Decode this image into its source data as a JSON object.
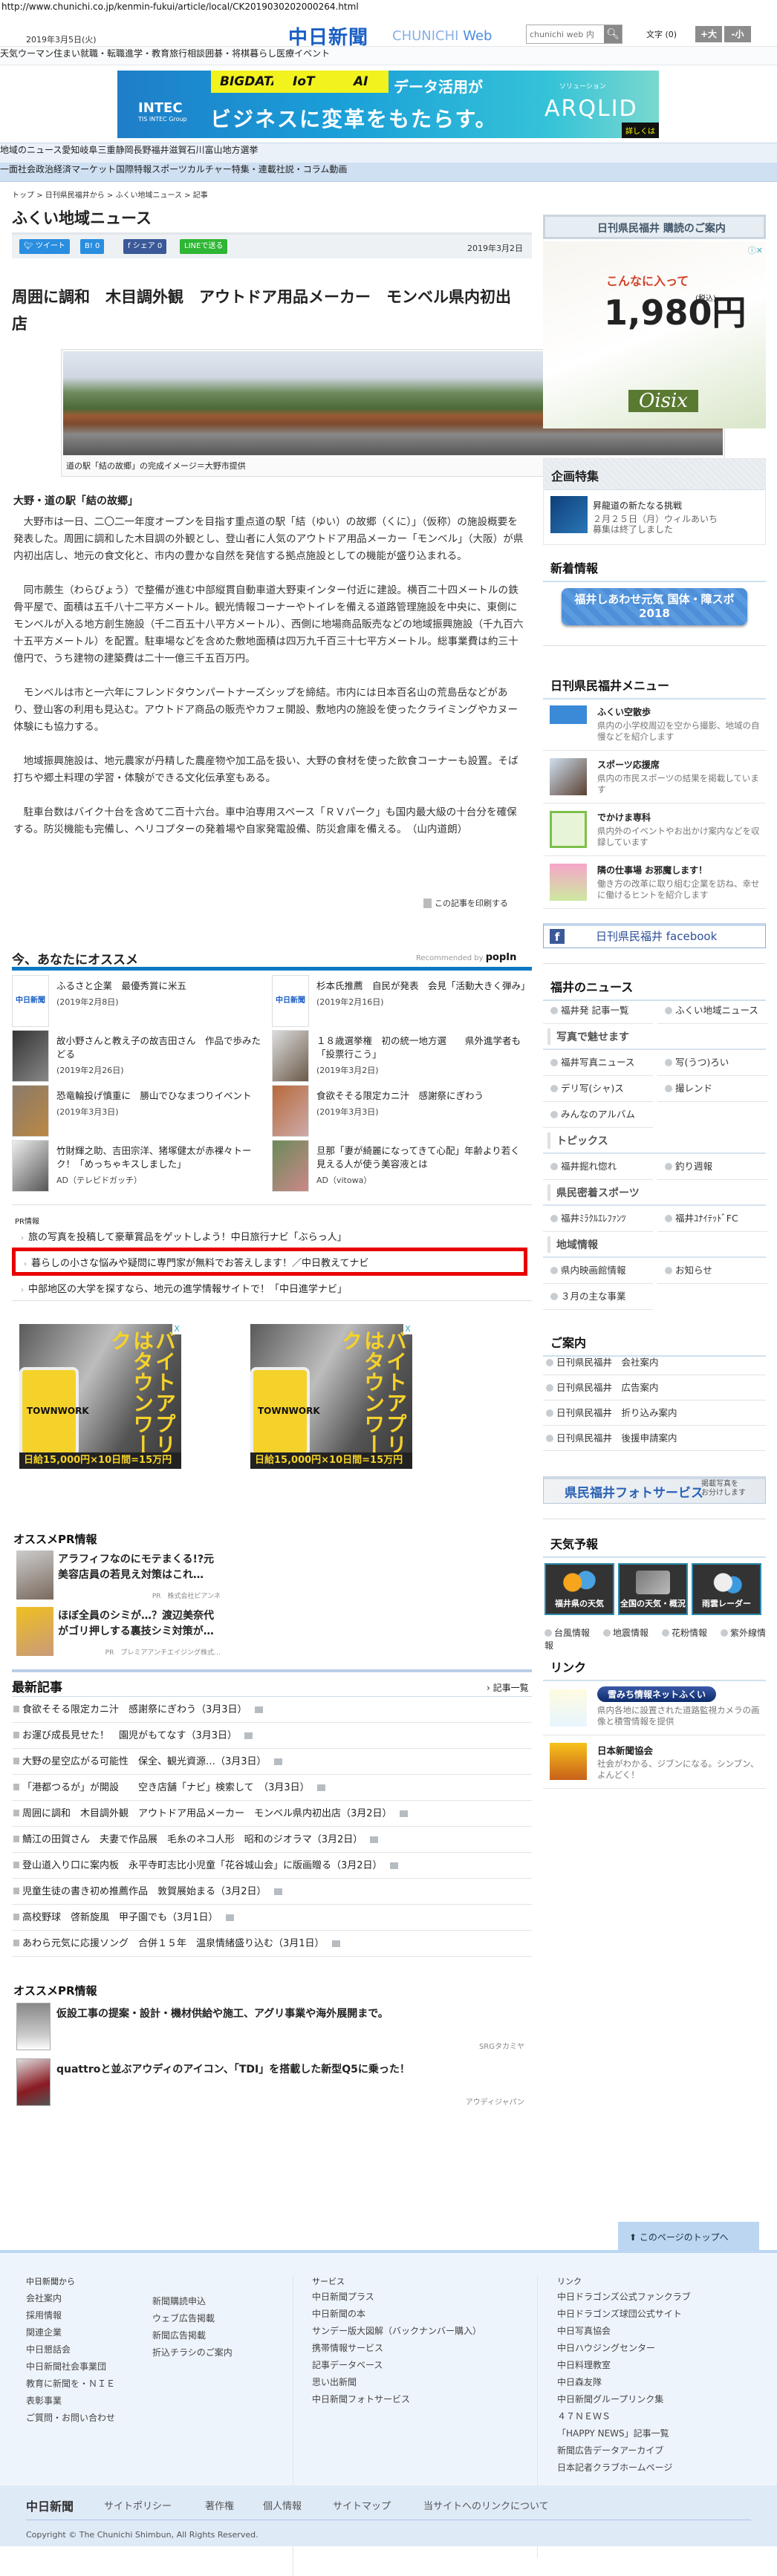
{
  "url": "http://www.chunichi.co.jp/kenmin-fukui/article/local/CK2019030202000264.html",
  "header": {
    "date": "2019年3月5日(火)",
    "logo_jp": "中日新聞",
    "logo_en_a": "CHUNICHI",
    "logo_en_b": "Web",
    "search_placeholder": "chunichi web 内",
    "font_size_label": "文字 (0)",
    "font_larger": "+大",
    "font_smaller": "-小"
  },
  "nav_top": [
    "天気",
    "ウーマン",
    "住まい",
    "就職・転職",
    "進学・教育",
    "旅行",
    "相談",
    "囲碁・将棋",
    "暮らし",
    "医療",
    "イベント"
  ],
  "banner_ad": {
    "company": "INTEC",
    "group": "TIS INTEC Group",
    "keywords": [
      "BIGDATA",
      "IoT",
      "AI"
    ],
    "line1": "データ活用が",
    "line2": "ビジネスに変革をもたらす。",
    "solution": "ソリューション",
    "product": "ARQLID",
    "more": "詳しくは"
  },
  "nav_region": [
    "地域のニュース",
    "愛知",
    "岐阜",
    "三重",
    "静岡",
    "長野",
    "福井",
    "滋賀",
    "石川",
    "富山",
    "地方選挙"
  ],
  "nav_category": [
    "一面",
    "社会",
    "政治",
    "経済",
    "マーケット",
    "国際",
    "特報",
    "スポーツ",
    "カルチャー",
    "特集・連載",
    "社説・コラム",
    "動画"
  ],
  "breadcrumb": "トップ > 日刊県民福井から > ふくい地域ニュース > 記事",
  "section_title": "ふくい地域ニュース",
  "share": {
    "tweet": "ツイート",
    "hatena": "B! 0",
    "facebook": "シェア 0",
    "line": "LINEで送る",
    "date": "2019年3月2日"
  },
  "article": {
    "headline": "周囲に調和　木目調外観　アウトドア用品メーカー　モンベル県内初出店",
    "caption": "道の駅「結の故郷」の完成イメージ＝大野市提供",
    "subhead": "大野・道の駅「結の故郷」",
    "paragraphs": [
      "大野市は一日、二〇二一年度オープンを目指す重点道の駅「結（ゆい）の故郷（くに）」（仮称）の施設概要を発表した。周囲に調和した木目調の外観とし、登山者に人気のアウトドア用品メーカー「モンベル」（大阪）が県内初出店し、地元の食文化と、市内の豊かな自然を発信する拠点施設としての機能が盛り込まれる。",
      "同市蕨生（わらびょう）で整備が進む中部縦貫自動車道大野東インター付近に建設。横百二十四メートルの鉄骨平屋で、面積は五千八十二平方メートル。観光情報コーナーやトイレを備える道路管理施設を中央に、東側にモンベルが入る地方創生施設（千二百五十八平方メートル）、西側に地場商品販売などの地域振興施設（千九百六十五平方メートル）を配置。駐車場などを含めた敷地面積は四万九千百三十七平方メートル。総事業費は約三十億円で、うち建物の建築費は二十一億三千五百万円。",
      "モンベルは市と一六年にフレンドタウンパートナーズシップを締結。市内には日本百名山の荒島岳などがあり、登山客の利用も見込む。アウトドア商品の販売やカフェ開設、敷地内の施設を使ったクライミングやカヌー体験にも協力する。",
      "地域振興施設は、地元農家が丹精した農産物や加工品を扱い、大野の食材を使った飲食コーナーも設置。そば打ちや郷土料理の学習・体験ができる文化伝承室もある。",
      "駐車台数はバイク十台を含めて二百十六台。車中泊専用スペース「ＲＶパーク」も国内最大級の十台分を確保する。防災機能も完備し、ヘリコプターの発着場や自家発電設備、防災倉庫を備える。　（山内道朗）"
    ],
    "print": "この記事を印刷する"
  },
  "recommend": {
    "title": "今、あなたにオススメ",
    "by": "Recommended by",
    "brand": "popIn",
    "items": [
      {
        "title": "ふるさと企業　最優秀賞に米五",
        "date": "(2019年2月8日)"
      },
      {
        "title": "杉本氏推薦　自民が発表　会見「活動大きく弾み」",
        "date": "(2019年2月16日)"
      },
      {
        "title": "故小野さんと教え子の故吉田さん　作品で歩みたどる",
        "date": "(2019年2月26日)"
      },
      {
        "title": "１８歳選挙権　初の統一地方選　　県外進学者も「投票行こう」",
        "date": "(2019年3月2日)"
      },
      {
        "title": "恐竜輪投げ慎重に　勝山でひなまつりイベント",
        "date": "(2019年3月3日)"
      },
      {
        "title": "食欲そそる限定カニ汁　感謝祭にぎわう",
        "date": "(2019年3月3日)"
      },
      {
        "title": "竹財輝之助、吉田宗洋、猪塚健太が赤裸々トーク！「めっちゃキスしました」",
        "date": "AD（テレビドガッチ）"
      },
      {
        "title": "旦那「妻が綺麗になってきて心配」年齢より若く見える人が使う美容液とは",
        "date": "AD（vitowa）"
      }
    ]
  },
  "pr_info": {
    "label": "PR情報",
    "items": [
      "旅の写真を投稿して豪華賞品をゲットしよう！中日旅行ナビ「ぶらっ人」",
      "暮らしの小さな悩みや疑問に専門家が無料でお答えします！／中日教えてナビ",
      "中部地区の大学を探すなら、地元の進学情報サイトで！「中日進学ナビ」"
    ]
  },
  "ads": {
    "headline": "バイトアプリはタウンワーク",
    "brand": "TOWNWORK",
    "bottom": "日給15,000円×10日間=15万円",
    "close": "X"
  },
  "pr_recommend_1": {
    "title": "オススメPR情報",
    "items": [
      {
        "title": "アラフィフなのにモテまくる!?元美容店員の若見え対策はこれ…",
        "sponsor": "PR　株式会社ビアンネ"
      },
      {
        "title": "ほぼ全員のシミが…？渡辺美奈代がゴリ押しする裏技シミ対策が…",
        "sponsor": "PR　プレミアアンチエイジング株式…"
      }
    ]
  },
  "latest": {
    "title": "最新記事",
    "more": "記事一覧",
    "items": [
      "食欲そそる限定カニ汁　感謝祭にぎわう（3月3日）",
      "お運び成長見せた！　園児がもてなす（3月3日）",
      "大野の星空広がる可能性　保全、観光資源…（3月3日）",
      "「港都つるが」が開設　　空き店舗「ナビ」検索して　（3月3日）",
      "周囲に調和　木目調外観　アウトドア用品メーカー　モンベル県内初出店（3月2日）",
      "鯖江の田賀さん　夫妻で作品展　毛糸のネコ人形　昭和のジオラマ（3月2日）",
      "登山道入り口に案内板　永平寺町志比小児童「花谷城山会」に版画贈る（3月2日）",
      "児童生徒の書き初め推薦作品　敦賀展始まる（3月2日）",
      "高校野球　啓新旋風　甲子園でも（3月1日）",
      "あわら元気に応援ソング　合併１５年　温泉情緒盛り込む（3月1日）"
    ]
  },
  "pr_recommend_2": {
    "title": "オススメPR情報",
    "items": [
      {
        "title": "仮設工事の提案・設計・機材供給や施工、アグリ事業や海外展開まで。",
        "sponsor": "SRGタカミヤ"
      },
      {
        "title": "quattroと並ぶアウディのアイコン、「TDI」を搭載した新型Q5に乗った！",
        "sponsor": "アウディジャパン"
      }
    ]
  },
  "sidebar": {
    "subscribe": "日刊県民福井 購読のご案内",
    "side_ad": {
      "line1": "こんなに入って",
      "price": "1,980円",
      "tax": "(税込)",
      "brand": "Oisix"
    },
    "kikaku": {
      "title": "企画特集",
      "item_title": "昇龍道の新たなる挑戦",
      "item_desc1": "２月２５日（月）ウィルあいち",
      "item_desc2": "募集は終了しました"
    },
    "shinchaku": {
      "title": "新着情報",
      "banner": "福井しあわせ元気 国体・障スポ2018"
    },
    "menu": {
      "title": "日刊県民福井メニュー",
      "items": [
        {
          "title": "ふくい空散歩",
          "desc": "県内の小学校周辺を空から撮影、地域の自慢などを紹介します"
        },
        {
          "title": "スポーツ応援席",
          "desc": "県内の市民スポーツの結果を掲載しています"
        },
        {
          "title": "でかけま専科",
          "desc": "県内外のイベントやお出かけ案内などを収録しています"
        },
        {
          "title": "隣の仕事場 お邪魔します！",
          "desc": "働き方の改革に取り組む企業を訪ね、幸せに働けるヒントを紹介します"
        }
      ]
    },
    "facebook": "日刊県民福井 facebook",
    "fukui_news": {
      "title": "福井のニュース",
      "rows": [
        {
          "type": "row",
          "items": [
            "福井発 記事一覧",
            "ふくい地域ニュース"
          ]
        },
        {
          "type": "sub",
          "label": "写真で魅せます"
        },
        {
          "type": "row",
          "items": [
            "福井写真ニュース",
            "写(うつ)ろい"
          ]
        },
        {
          "type": "row",
          "items": [
            "デリ写(シャ)ス",
            "撮レンド"
          ]
        },
        {
          "type": "row",
          "items": [
            "みんなのアルバム"
          ]
        },
        {
          "type": "sub",
          "label": "トピックス"
        },
        {
          "type": "row",
          "items": [
            "福井掘れ惚れ",
            "釣り週報"
          ]
        },
        {
          "type": "sub",
          "label": "県民密着スポーツ"
        },
        {
          "type": "row",
          "items": [
            "福井ﾐﾗｸﾙｴﾚﾌｧﾝﾂ",
            "福井ﾕﾅｲﾃｯﾄﾞFC"
          ]
        },
        {
          "type": "sub",
          "label": "地域情報"
        },
        {
          "type": "row",
          "items": [
            "県内映画館情報",
            "お知らせ"
          ]
        },
        {
          "type": "row",
          "items": [
            "３月の主な事業"
          ]
        }
      ]
    },
    "annai": {
      "title": "ご案内",
      "items": [
        "日刊県民福井　会社案内",
        "日刊県民福井　広告案内",
        "日刊県民福井　折り込み案内",
        "日刊県民福井　後援申請案内"
      ]
    },
    "photo_service": {
      "title": "県民福井フォトサービス",
      "sub1": "掲載写真を",
      "sub2": "お分けします"
    },
    "weather": {
      "title": "天気予報",
      "tiles": [
        "福井県の天気",
        "全国の天気・概況",
        "雨雲レーダー"
      ],
      "links": [
        "台風情報",
        "地震情報",
        "花粉情報",
        "紫外線情報"
      ]
    },
    "links": {
      "title": "リンク",
      "items": [
        {
          "title": "雪みち情報ネットふくい",
          "desc": "県内各地に設置された道路監視カメラの画像と積雪情報を提供"
        },
        {
          "title": "日本新聞協会",
          "desc": "社会がわかる、ジブンになる。シンブン、よんどく！"
        }
      ]
    }
  },
  "footer": {
    "to_top": "このページのトップへ",
    "col1_title": "中日新聞から",
    "col1a": [
      "会社案内",
      "採用情報",
      "関連企業",
      "中日懇話会",
      "中日新聞社会事業団",
      "教育に新聞を・ＮＩＥ",
      "表彰事業",
      "ご質問・お問い合わせ"
    ],
    "col1b": [
      "新聞購読申込",
      "ウェブ広告掲載",
      "新聞広告掲載",
      "折込チラシのご案内"
    ],
    "col2_title": "サービス",
    "col2": [
      "中日新聞プラス",
      "中日新聞の本",
      "サンデー版大図解（バックナンバー購入）",
      "携帯情報サービス",
      "記事データベース",
      "思い出新聞",
      "中日新聞フォトサービス"
    ],
    "col3_title": "リンク",
    "col3": [
      "中日ドラゴンズ公式ファンクラブ",
      "中日ドラゴンズ球団公式サイト",
      "中日写真協会",
      "中日ハウジングセンター",
      "中日料理教室",
      "中日森友隊",
      "中日新聞グループリンク集",
      "４７ＮＥＷＳ",
      "「HAPPY NEWS」記事一覧",
      "新聞広告データアーカイブ",
      "日本記者クラブホームページ"
    ],
    "bottom_logo": "中日新聞",
    "bottom_links": [
      "サイトポリシー",
      "著作権",
      "個人情報",
      "サイトマップ",
      "当サイトへのリンクについて"
    ],
    "copyright": "Copyright © The Chunichi Shimbun, All Rights Reserved."
  },
  "colors": {
    "brand_blue": "#1a5fc4",
    "nav_light": "#eaf1f9",
    "nav_mid": "#cfe0f2",
    "recommend_bar": "#0a78c2",
    "highlight_red": "#e80000"
  }
}
